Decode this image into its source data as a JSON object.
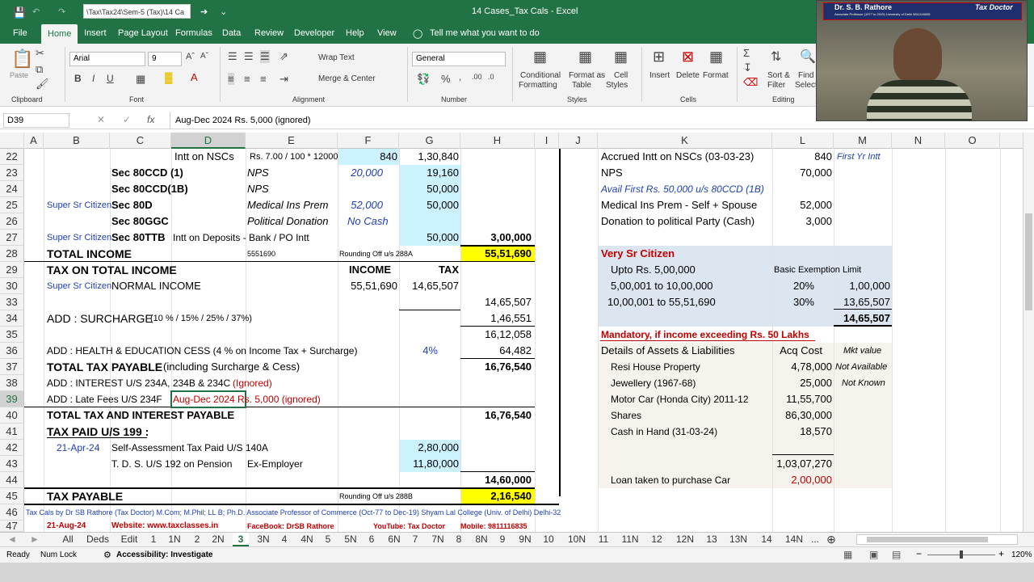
{
  "titlebar": {
    "path": "\\Tax\\Tax24\\Sem-5 (Tax)\\14 Ca",
    "title": "14 Cases_Tax Cals  -  Excel"
  },
  "menu": [
    "File",
    "Home",
    "Insert",
    "Page Layout",
    "Formulas",
    "Data",
    "Review",
    "Developer",
    "Help",
    "View"
  ],
  "tell_me": "Tell me what you want to do",
  "ribbon": {
    "paste": "Paste",
    "clipboard": "Clipboard",
    "font_name": "Arial",
    "font_size": "9",
    "font_group": "Font",
    "wrap_text": "Wrap Text",
    "merge_center": "Merge & Center",
    "alignment": "Alignment",
    "number_format": "General",
    "number": "Number",
    "conditional": "Conditional",
    "formatting": "Formatting",
    "format_as": "Format as",
    "table": "Table",
    "cell": "Cell",
    "styles_btn": "Styles",
    "styles": "Styles",
    "insert": "Insert",
    "delete": "Delete",
    "format": "Format",
    "cells": "Cells",
    "sort": "Sort &",
    "filter": "Filter",
    "find": "Find",
    "select": "Select",
    "editing": "Editing"
  },
  "namebox": "D39",
  "formula": "Aug-Dec 2024 Rs. 5,000 (ignored)",
  "columns": [
    "A",
    "B",
    "C",
    "D",
    "E",
    "F",
    "G",
    "H",
    "I",
    "J",
    "K",
    "L",
    "M",
    "N",
    "O"
  ],
  "rows": [
    "22",
    "23",
    "24",
    "25",
    "26",
    "27",
    "28",
    "29",
    "30",
    "33",
    "34",
    "35",
    "36",
    "37",
    "38",
    "39",
    "40",
    "41",
    "42",
    "43",
    "44",
    "45",
    "46",
    "47"
  ],
  "cells": {
    "r22_d": "Intt on NSCs",
    "r22_e": "Rs. 7.00 / 100 * 12000",
    "r22_f": "840",
    "r22_g": "1,30,840",
    "r22_k": "Accrued Intt on NSCs (03-03-23)",
    "r22_l": "840",
    "r22_m": "First Yr  Intt",
    "r23_c": "Sec 80CCD (1)",
    "r23_e": "NPS",
    "r23_f": "20,000",
    "r23_g": "19,160",
    "r23_k": "NPS",
    "r23_l": "70,000",
    "r24_c": "Sec  80CCD(1B)",
    "r24_e": "NPS",
    "r24_g": "50,000",
    "r24_k": "Avail First Rs. 50,000 u/s  80CCD (1B)",
    "r25_b": "Super Sr Citizen",
    "r25_c": "Sec 80D",
    "r25_e": "Medical Ins Prem",
    "r25_f": "52,000",
    "r25_g": "50,000",
    "r25_k": "Medical Ins Prem - Self + Spouse",
    "r25_l": "52,000",
    "r26_c": "Sec 80GGC",
    "r26_e": "Political Donation",
    "r26_f": "No Cash",
    "r26_k": "Donation to political Party (Cash)",
    "r26_l": "3,000",
    "r27_b": "Super Sr Citizen",
    "r27_c": "Sec 80TTB",
    "r27_d": "Intt on Deposits - Bank / PO Intt",
    "r27_g": "50,000",
    "r27_h": "3,00,000",
    "r28_b": "TOTAL  INCOME",
    "r28_e": "5551690",
    "r28_f": "Rounding Off u/s 288A",
    "r28_h": "55,51,690",
    "r28_k": "Very Sr Citizen",
    "r29_b": "TAX ON TOTAL INCOME",
    "r29_f": "INCOME",
    "r29_g": "TAX",
    "r29_k": "Upto Rs. 5,00,000",
    "r29_l": "Basic Exemption Limit",
    "r30_b": "Super Sr Citizen",
    "r30_c": "NORMAL INCOME",
    "r30_f": "55,51,690",
    "r30_g": "14,65,507",
    "r30_k": "5,00,001  to 10,00,000",
    "r30_l": "20%",
    "r30_m": "1,00,000",
    "r33_h": "14,65,507",
    "r33_k": "10,00,001  to 55,51,690",
    "r33_l": "30%",
    "r33_m": "13,65,507",
    "r34_b": "ADD : SURCHARGE",
    "r34_b2": "(10 % / 15% / 25% / 37%)",
    "r34_h": "1,46,551",
    "r34_m": "14,65,507",
    "r35_h": "16,12,058",
    "r35_k": "Mandatory, if income exceeding Rs. 50 Lakhs",
    "r36_b": "ADD : HEALTH & EDUCATION CESS (4 % on Income Tax + Surcharge)",
    "r36_g": "4%",
    "r36_h": "64,482",
    "r36_k": "Details of Assets & Liabilities",
    "r36_l": "Acq Cost",
    "r36_m": "Mkt value",
    "r37_b": "TOTAL TAX PAYABLE",
    "r37_b2": "(including Surcharge & Cess)",
    "r37_h": "16,76,540",
    "r37_k": "Resi House Property",
    "r37_l": "4,78,000",
    "r37_m": "Not Available",
    "r38_b": "ADD : INTEREST U/S 234A, 234B & 234C",
    "r38_b2": "(Ignored)",
    "r38_k": "Jewellery (1967-68)",
    "r38_l": "25,000",
    "r38_m": "Not Known",
    "r39_b": "ADD : Late Fees U/S 234F",
    "r39_d": "Aug-Dec 2024 Rs. 5,000 (ignored)",
    "r39_k": "Motor Car (Honda City) 2011-12",
    "r39_l": "11,55,700",
    "r40_b": "TOTAL TAX AND INTEREST PAYABLE",
    "r40_h": "16,76,540",
    "r40_k": "Shares",
    "r40_l": "86,30,000",
    "r41_b": "TAX PAID U/S 199 :",
    "r41_k": "Cash in Hand (31-03-24)",
    "r41_l": "18,570",
    "r42_b": "21-Apr-24",
    "r42_c": "Self-Assessment Tax Paid  U/S 140A",
    "r42_g": "2,80,000",
    "r43_c": "T. D. S.  U/S 192 on Pension",
    "r43_e": "Ex-Employer",
    "r43_g": "11,80,000",
    "r43_l": "1,03,07,270",
    "r44_h": "14,60,000",
    "r44_k": "Loan taken to purchase Car",
    "r44_l": "2,00,000",
    "r45_b": "TAX  PAYABLE",
    "r45_f": "Rounding Off u/s 288B",
    "r45_h": "2,16,540",
    "r46_a": "Tax Cals by Dr SB Rathore (Tax Doctor) M.Com; M.Phil; LL B; Ph.D. Associate Professor of Commerce (Oct-77 to Dec-19) Shyam Lal College (Univ. of Delhi) Delhi-32",
    "r47_b": "21-Aug-24",
    "r47_c": "Website: www.taxclasses.in",
    "r47_e": "FaceBook: DrSB Rathore",
    "r47_f": "YouTube: Tax Doctor",
    "r47_g": "Mobile: 9811116835"
  },
  "tabs": [
    "All",
    "Deds",
    "Edit",
    "1",
    "1N",
    "2",
    "2N",
    "3",
    "3N",
    "4",
    "4N",
    "5",
    "5N",
    "6",
    "6N",
    "7",
    "7N",
    "8",
    "8N",
    "9",
    "9N",
    "10",
    "10N",
    "11",
    "11N",
    "12",
    "12N",
    "13",
    "13N",
    "14",
    "14N",
    "..."
  ],
  "status": {
    "ready": "Ready",
    "numlock": "Num Lock",
    "accessibility": "Accessibility: Investigate",
    "zoom": "120%"
  },
  "video_caption": {
    "name": "Dr. S. B. Rathore",
    "line2": "Associate Professor (1977 to 2019) University of Delhi 9811116835",
    "brand": "Tax Doctor"
  },
  "colors": {
    "excel_green": "#217346",
    "yellow": "#ffff00",
    "light_blue": "#ccf2ff",
    "blue_gray": "#dce6f0"
  }
}
